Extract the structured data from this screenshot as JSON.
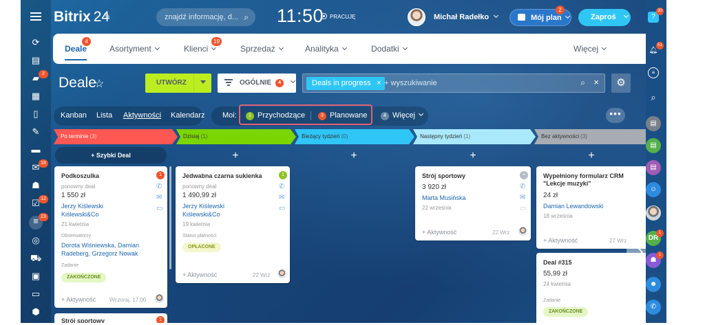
{
  "header": {
    "logo_main": "Bitrix",
    "logo_num": "24",
    "search_placeholder": "znajdź informację, d...",
    "clock": "11:50",
    "status": "PRACUJĘ",
    "user_name": "Michał Radełko",
    "plan_label": "Mój plan",
    "plan_badge": "2",
    "invite_label": "Zaproś"
  },
  "left_badges": {
    "chat": "2",
    "mail": "18",
    "tasks": "12",
    "crm": "23"
  },
  "topnav": {
    "items": [
      "Deale",
      "Asortyment",
      "Klienci",
      "Sprzedaż",
      "Analityka",
      "Dodatki"
    ],
    "deale_badge": "4",
    "klienci_badge": "19",
    "more": "Więcej"
  },
  "page": {
    "title": "Deale",
    "create_label": "UTWÓRZ",
    "filter_label": "OGÓLNIE",
    "filter_badge": "4",
    "pill": "Deals in progress",
    "search_placeholder": "+ wyszukiwanie"
  },
  "views": [
    "Kanban",
    "Lista",
    "Aktywności",
    "Kalendarz"
  ],
  "moi": {
    "label": "Moi:",
    "incoming": "Przychodzące",
    "incoming_count": "1",
    "planned": "Planowane",
    "planned_count": "3",
    "more": "Więcej",
    "more_count": "4"
  },
  "stages": [
    {
      "name": "Po terminie",
      "count": "(3)",
      "color": "#ff5752"
    },
    {
      "name": "Dzisiaj",
      "count": "(1)",
      "color": "#7bd500"
    },
    {
      "name": "Bieżący tydzień",
      "count": "(0)",
      "color": "#2fc6f6"
    },
    {
      "name": "Następny tydzień",
      "count": "(1)",
      "color": "#aae9fc"
    },
    {
      "name": "Bez aktywności",
      "count": "(3)",
      "color": "#a8adb4"
    }
  ],
  "quick_deal": "+ Szybki Deal",
  "cards": {
    "c1": {
      "title": "Podkoszulka",
      "sub": "ponowny deal",
      "amount": "1 550 zł",
      "link1": "Jerzy Kiślewski",
      "link2": "Kiślewski&Co",
      "date": "21 kwietnia",
      "obs_label": "Obserwatorzy",
      "obs1": "Dorota Wiśniewska, Damian",
      "obs2": "Radeberg, Grzegorz Nowak",
      "task_label": "Zadanie",
      "status": "ZAKOŃCZONE",
      "activity": "+ Aktywność",
      "act_date": "Wczoraj, 17:00",
      "badge": "1"
    },
    "c1b": {
      "title": "Strój sportowy",
      "badge": "1"
    },
    "c2": {
      "title": "Jedwabna czarna sukienka",
      "sub": "ponowny deal",
      "amount": "1 490,99 zł",
      "link1": "Jerzy Kiślewski",
      "link2": "Kiślewski&Co",
      "date": "19 kwietnia",
      "pay_label": "Status płatności",
      "status": "OPŁACONE",
      "activity": "+ Aktywność",
      "act_date": "22 Wrz",
      "badge": "1"
    },
    "c3": {
      "title": "Strój sportowy",
      "amount": "3 920 zł",
      "link1": "Marta Musińska",
      "date": "22 września",
      "activity": "+ Aktywność",
      "act_date": "22 Wrz"
    },
    "c4": {
      "title1": "Wypełniony formularz CRM",
      "title2": "\"Lekcje muzyki\"",
      "amount": "24 zł",
      "link1": "Damian Lewandowski",
      "date": "18 września",
      "activity": "+ Aktywność",
      "act_date": "27 Wrz"
    },
    "c5": {
      "title": "Deal #315",
      "amount": "55,99 zł",
      "date": "24 kwietnia",
      "task_label": "Zadanie",
      "status": "ZAKOŃCZONE"
    }
  },
  "right_badges": {
    "help": "30",
    "bell": "51",
    "dr": "1",
    "team": "1"
  },
  "right_initials": "DR"
}
